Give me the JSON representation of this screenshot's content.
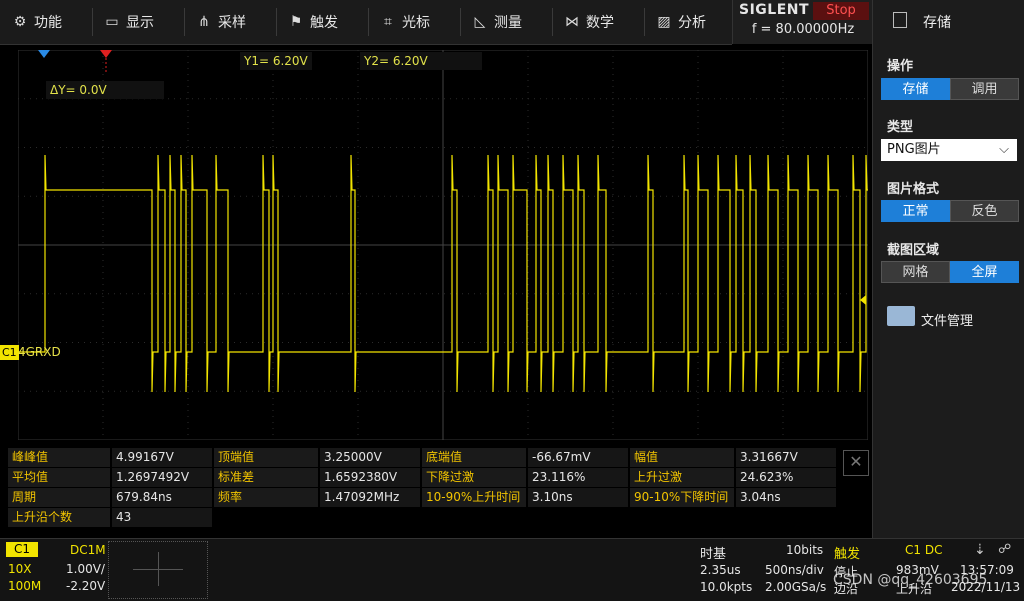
{
  "menu": [
    {
      "label": "功能",
      "icon": "gear-icon",
      "glyph": "⚙"
    },
    {
      "label": "显示",
      "icon": "display-icon",
      "glyph": "▭"
    },
    {
      "label": "采样",
      "icon": "sample-icon",
      "glyph": "⋔"
    },
    {
      "label": "触发",
      "icon": "flag-icon",
      "glyph": "⚑"
    },
    {
      "label": "光标",
      "icon": "cursor-icon",
      "glyph": "⌗"
    },
    {
      "label": "测量",
      "icon": "measure-icon",
      "glyph": "◺"
    },
    {
      "label": "数学",
      "icon": "math-icon",
      "glyph": "⋈"
    },
    {
      "label": "分析",
      "icon": "analyze-icon",
      "glyph": "▨"
    }
  ],
  "brand": {
    "logo": "SIGLENT",
    "status": "Stop",
    "freq": "f = 80.00000Hz"
  },
  "panel": {
    "title": "存储",
    "op_label": "操作",
    "op_btns": [
      "存储",
      "调用"
    ],
    "type_label": "类型",
    "type_value": "PNG图片",
    "fmt_label": "图片格式",
    "fmt_btns": [
      "正常",
      "反色"
    ],
    "area_label": "截图区域",
    "area_btns": [
      "网格",
      "全屏"
    ],
    "file_mgr": "文件管理"
  },
  "cursors": {
    "y1": "Y1= 6.20V",
    "y2": "Y2= 6.20V",
    "dy": "ΔY= 0.0V"
  },
  "channel": {
    "tag": "C1",
    "name": "4GRXD",
    "color": "#f2e400"
  },
  "measurements": [
    [
      [
        "峰峰值",
        "4.99167V"
      ],
      [
        "顶端值",
        "3.25000V"
      ],
      [
        "底端值",
        "-66.67mV"
      ],
      [
        "幅值",
        "3.31667V"
      ]
    ],
    [
      [
        "平均值",
        "1.2697492V"
      ],
      [
        "标准差",
        "1.6592380V"
      ],
      [
        "下降过激",
        "23.116%"
      ],
      [
        "上升过激",
        "24.623%"
      ]
    ],
    [
      [
        "周期",
        "679.84ns"
      ],
      [
        "频率",
        "1.47092MHz"
      ],
      [
        "10-90%上升时间",
        "3.10ns"
      ],
      [
        "90-10%下降时间",
        "3.04ns"
      ]
    ],
    [
      [
        "上升沿个数",
        "43"
      ]
    ]
  ],
  "bottom": {
    "ch": "C1",
    "coupling": "DC1M",
    "probe": "10X",
    "vdiv": "1.00V/",
    "imp": "100M",
    "offset": "-2.20V",
    "tb_label": "时基",
    "bits": "10bits",
    "delay": "2.35us",
    "tdiv": "500ns/div",
    "pts": "10.0kpts",
    "rate": "2.00GSa/s",
    "trig_label": "触发",
    "trig_src": "C1 DC",
    "trig_mode": "停止",
    "trig_level": "983mV",
    "trig_edge_label": "边沿",
    "trig_slope": "上升沿",
    "time": "13:57:09",
    "date": "2022/11/13",
    "watermark": "CSDN @qq_42603695"
  },
  "close_glyph": "✕"
}
